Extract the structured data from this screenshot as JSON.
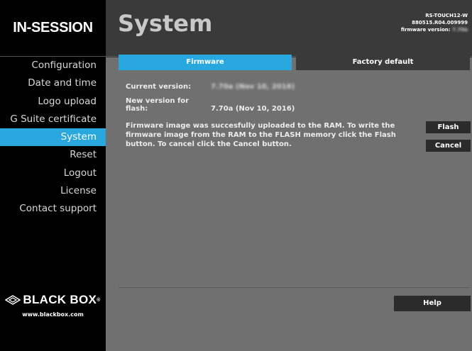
{
  "brand": {
    "name": "IN-SESSION"
  },
  "sidebar": {
    "items": [
      {
        "label": "Configuration"
      },
      {
        "label": "Date and time"
      },
      {
        "label": "Logo upload"
      },
      {
        "label": "G Suite certificate"
      },
      {
        "label": "System"
      },
      {
        "label": "Reset"
      },
      {
        "label": "Logout"
      },
      {
        "label": "License"
      },
      {
        "label": "Contact support"
      }
    ],
    "active_index": 4
  },
  "logo": {
    "wordmark": "BLACK BOX",
    "mark_symbol": "®",
    "url": "www.blackbox.com"
  },
  "header": {
    "title": "System",
    "device_model": "RS-TOUCH12-W",
    "device_serial": "880515.R04.009999",
    "firmware_label": "firmware version:",
    "firmware_value": "7.70a"
  },
  "tabs": [
    {
      "label": "Firmware",
      "active": true
    },
    {
      "label": "Factory default",
      "active": false
    }
  ],
  "firmware": {
    "current_label": "Current version:",
    "current_value": "7.70a (Nov 10, 2016)",
    "new_label": "New version for flash:",
    "new_value": "7.70a (Nov 10, 2016)",
    "message": "Firmware image was succesfully uploaded to the RAM. To write the firmware image from the RAM to the FLASH memory click the Flash button. To cancel click the Cancel button."
  },
  "buttons": {
    "flash": "Flash",
    "cancel": "Cancel",
    "help": "Help"
  },
  "colors": {
    "accent": "#29a8e0",
    "sidebar_bg": "#000000",
    "panel_bg": "#707070",
    "header_bg": "#3a3a3a",
    "button_bg": "#2b2b2b"
  }
}
